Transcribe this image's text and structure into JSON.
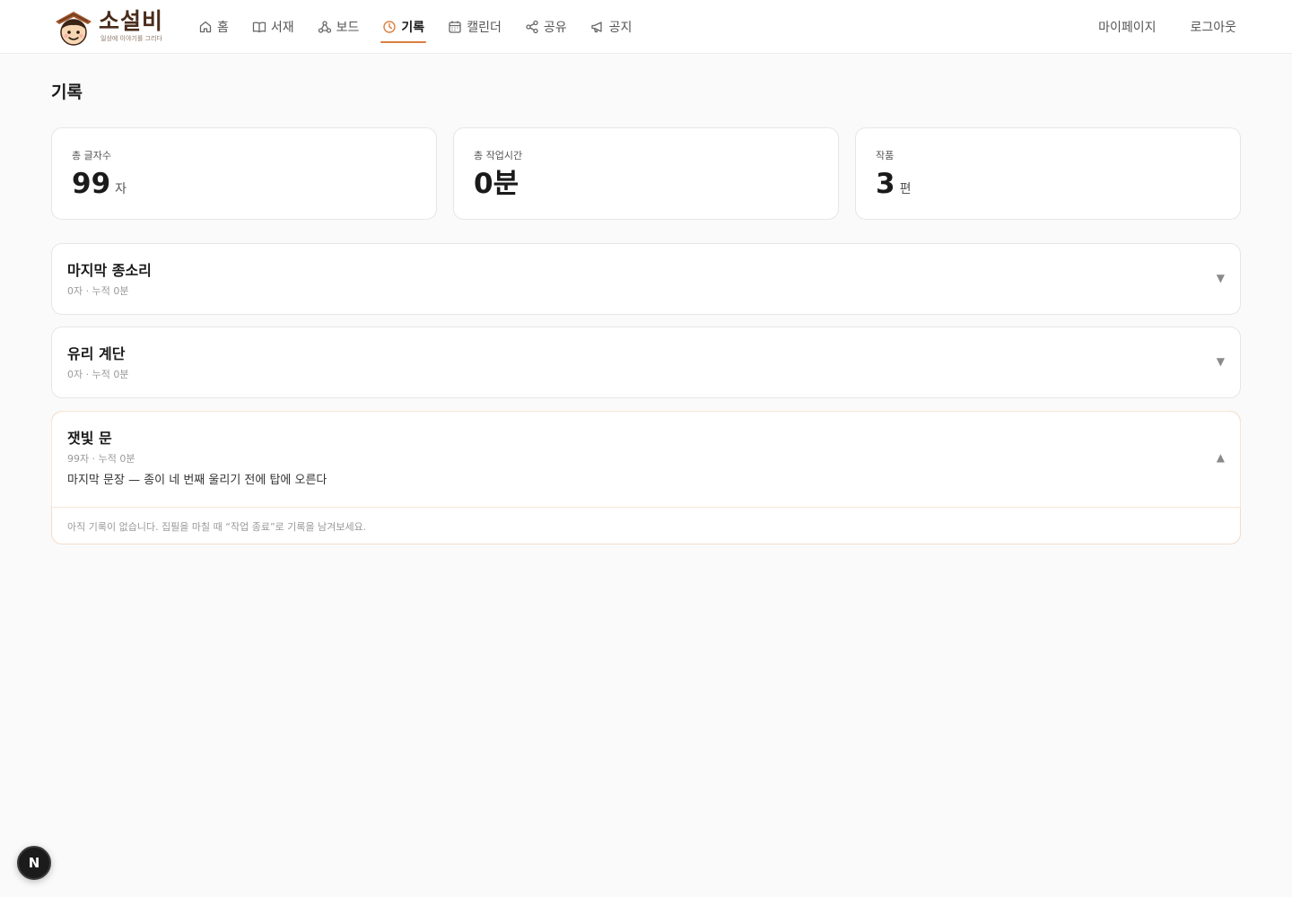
{
  "app": {
    "logo_title": "소설비",
    "logo_subtitle": "일상에 이야기를 그리다"
  },
  "nav": {
    "items": [
      {
        "label": "홈",
        "icon": "home-icon"
      },
      {
        "label": "서재",
        "icon": "book-icon"
      },
      {
        "label": "보드",
        "icon": "board-icon"
      },
      {
        "label": "기록",
        "icon": "clock-icon",
        "active": true
      },
      {
        "label": "캘린더",
        "icon": "calendar-icon"
      },
      {
        "label": "공유",
        "icon": "share-icon"
      },
      {
        "label": "공지",
        "icon": "megaphone-icon"
      }
    ],
    "mypage": "마이페이지",
    "logout": "로그아웃"
  },
  "page": {
    "title": "기록"
  },
  "stats": [
    {
      "label": "총 글자수",
      "value": "99",
      "unit": "자"
    },
    {
      "label": "총 작업시간",
      "value": "0분",
      "unit": ""
    },
    {
      "label": "작품",
      "value": "3",
      "unit": "편"
    }
  ],
  "works": [
    {
      "title": "마지막 종소리",
      "meta": "0자 · 누적 0분",
      "chevron": "▼",
      "expanded": false
    },
    {
      "title": "유리 계단",
      "meta": "0자 · 누적 0분",
      "chevron": "▼",
      "expanded": false
    },
    {
      "title": "잿빛 문",
      "meta": "99자 · 누적 0분",
      "last_sentence": "마지막 문장 — 종이 네 번째 울리기 전에 탑에 오른다",
      "chevron": "▲",
      "expanded": true,
      "empty_message": "아직 기록이 없습니다. 집필을 마칠 때 “작업 종료”로 기록을 남겨보세요."
    }
  ],
  "dev_badge": "N",
  "colors": {
    "accent": "#d9803f",
    "logo_brown": "#4a2c1a",
    "background": "#fafafa"
  }
}
